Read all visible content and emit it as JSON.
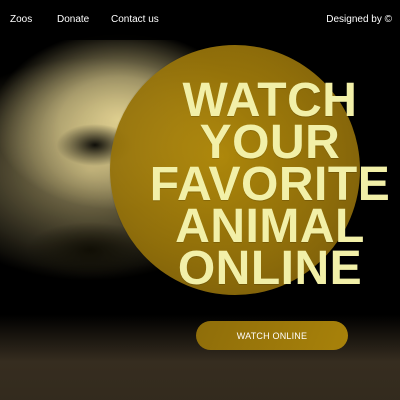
{
  "nav": {
    "items": [
      "Zoos",
      "Donate",
      "Contact us"
    ],
    "credit": "Designed by ©"
  },
  "hero": {
    "headline_lines": [
      "WATCH",
      "YOUR",
      "FAVORITE",
      "ANIMAL",
      "ONLINE"
    ],
    "cta_label": "WATCH ONLINE",
    "accent_color": "#9B7A0D",
    "headline_color": "#F2F0A8"
  }
}
